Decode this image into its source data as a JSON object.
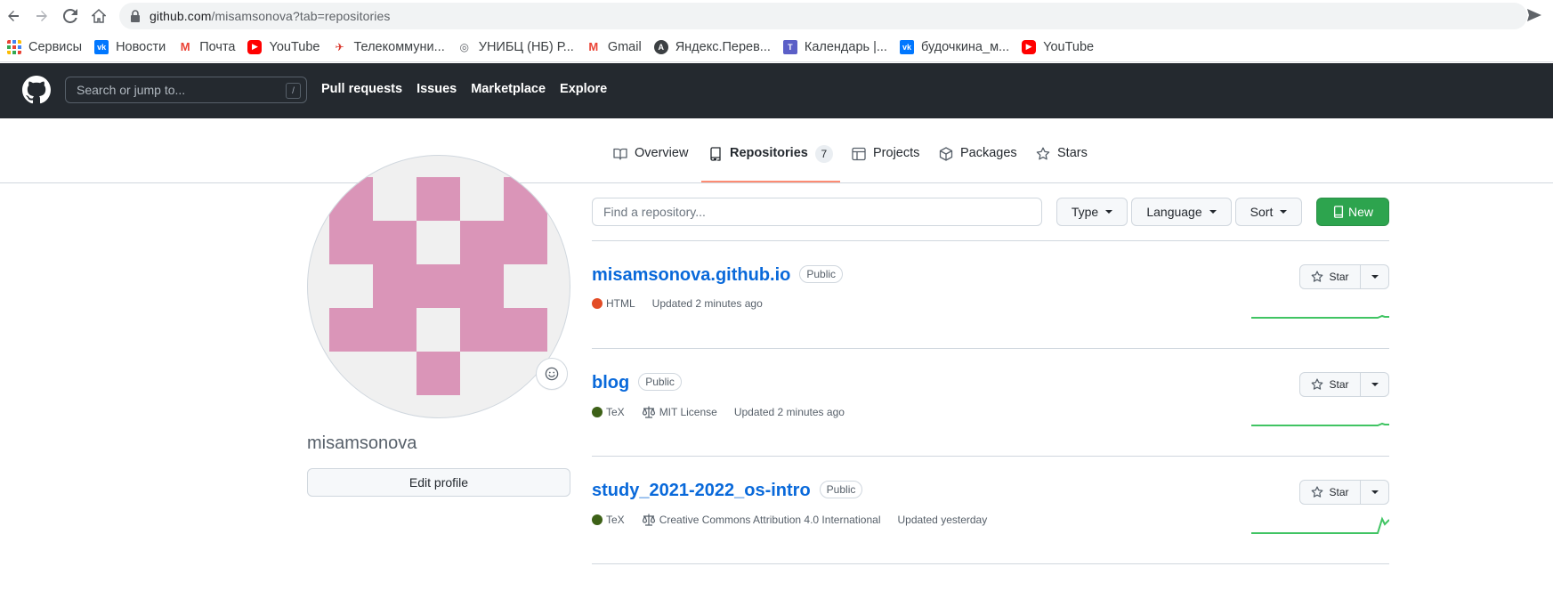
{
  "browser": {
    "url_host": "github.com",
    "url_path": "/misamsonova?tab=repositories",
    "bookmarks": [
      {
        "label": "Сервисы",
        "icon": "apps-grid-icon",
        "color": "#ea4335"
      },
      {
        "label": "Новости",
        "icon": "vk-icon",
        "color": "#0077ff"
      },
      {
        "label": "Почта",
        "icon": "gmail-icon",
        "color": "#ea4335"
      },
      {
        "label": "YouTube",
        "icon": "youtube-icon",
        "color": "#ff0000"
      },
      {
        "label": "Телекоммуни...",
        "icon": "bookmark-site-icon",
        "color": "#d93025"
      },
      {
        "label": "УНИБЦ (НБ) Р...",
        "icon": "bookmark-site-icon",
        "color": "#5f6368"
      },
      {
        "label": "Gmail",
        "icon": "gmail-icon",
        "color": "#ea4335"
      },
      {
        "label": "Яндекс.Перев...",
        "icon": "yandex-translate-icon",
        "color": "#3c4043"
      },
      {
        "label": "Календарь |...",
        "icon": "teams-icon",
        "color": "#5b5fc7"
      },
      {
        "label": "будочкина_м...",
        "icon": "vk-icon",
        "color": "#0077ff"
      },
      {
        "label": "YouTube",
        "icon": "youtube-icon",
        "color": "#ff0000"
      }
    ]
  },
  "header": {
    "search_placeholder": "Search or jump to...",
    "search_hotkey": "/",
    "nav": [
      "Pull requests",
      "Issues",
      "Marketplace",
      "Explore"
    ]
  },
  "tabs": [
    {
      "label": "Overview",
      "icon": "book-icon"
    },
    {
      "label": "Repositories",
      "icon": "repo-icon",
      "count": "7",
      "active": true
    },
    {
      "label": "Projects",
      "icon": "table-icon"
    },
    {
      "label": "Packages",
      "icon": "package-icon"
    },
    {
      "label": "Stars",
      "icon": "star-icon"
    }
  ],
  "profile": {
    "username": "misamsonova",
    "edit_label": "Edit profile",
    "avatar_color": "#da95b8"
  },
  "filters": {
    "find_placeholder": "Find a repository...",
    "type_label": "Type",
    "language_label": "Language",
    "sort_label": "Sort",
    "new_label": "New"
  },
  "repos": [
    {
      "name": "misamsonova.github.io",
      "visibility": "Public",
      "language": "HTML",
      "lang_color": "#e34c26",
      "license": "",
      "updated": "Updated 2 minutes ago",
      "star_label": "Star"
    },
    {
      "name": "blog",
      "visibility": "Public",
      "language": "TeX",
      "lang_color": "#3d6117",
      "license": "MIT License",
      "updated": "Updated 2 minutes ago",
      "star_label": "Star"
    },
    {
      "name": "study_2021-2022_os-intro",
      "visibility": "Public",
      "language": "TeX",
      "lang_color": "#3d6117",
      "license": "Creative Commons Attribution 4.0 International",
      "updated": "Updated yesterday",
      "star_label": "Star"
    }
  ],
  "colors": {
    "header_bg": "#24292f",
    "link": "#0969da",
    "primary_button": "#2da44e",
    "tab_underline": "#fd8c73"
  }
}
